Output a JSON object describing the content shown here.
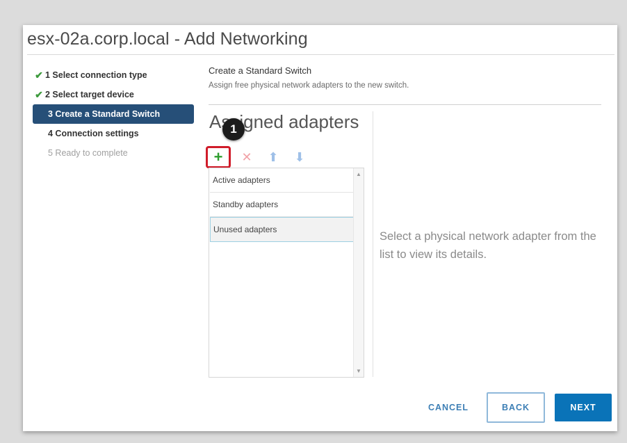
{
  "dialog": {
    "title": "esx-02a.corp.local - Add Networking"
  },
  "steps": [
    {
      "label": "1 Select connection type",
      "state": "done"
    },
    {
      "label": "2 Select target device",
      "state": "done"
    },
    {
      "label": "3 Create a Standard Switch",
      "state": "active"
    },
    {
      "label": "4 Connection settings",
      "state": "pending"
    },
    {
      "label": "5 Ready to complete",
      "state": "disabled"
    }
  ],
  "content": {
    "heading": "Create a Standard Switch",
    "subheading": "Assign free physical network adapters to the new switch."
  },
  "assigned": {
    "title": "Assigned adapters",
    "callout_number": "1",
    "toolbar": {
      "add_icon": "plus-icon",
      "remove_icon": "x-icon",
      "move_up_icon": "arrow-up-icon",
      "move_down_icon": "arrow-down-icon"
    },
    "items": [
      {
        "label": "Active adapters"
      },
      {
        "label": "Standby adapters"
      },
      {
        "label": "Unused adapters",
        "selected": true
      }
    ]
  },
  "details": {
    "message": "Select a physical network adapter from the list to view its details."
  },
  "footer": {
    "cancel": "CANCEL",
    "back": "BACK",
    "next": "NEXT"
  },
  "colors": {
    "active_step_bg": "#264f78",
    "check_green": "#3c9a3c",
    "primary": "#0a73b8",
    "highlight_red": "#d01c2a"
  }
}
